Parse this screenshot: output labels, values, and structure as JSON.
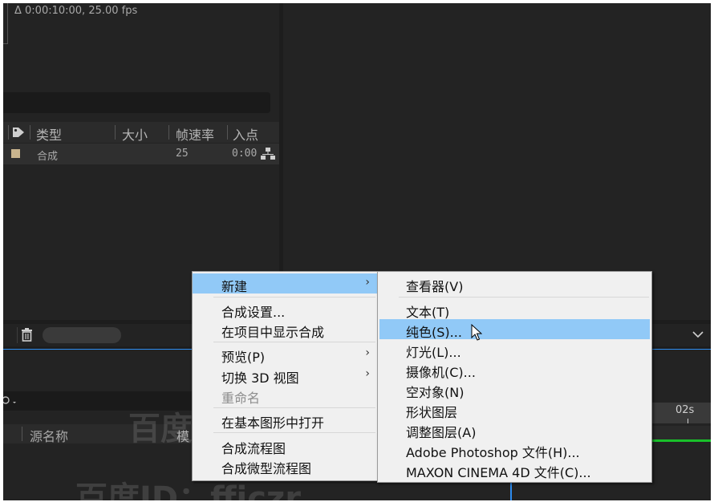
{
  "project_panel": {
    "comp_info": "Δ 0:00:10:00, 25.00 fps",
    "columns": {
      "type": "类型",
      "size": "大小",
      "framerate": "帧速率",
      "in_point": "入点"
    },
    "row": {
      "type": "合成",
      "framerate": "25",
      "in_point": "0:00"
    }
  },
  "timeline": {
    "source_name_col": "源名称",
    "mode_col_partial": "模",
    "time_marker": "02s"
  },
  "context_menu": {
    "items": [
      {
        "label": "新建",
        "submenu": "›"
      },
      {
        "label": "合成设置..."
      },
      {
        "label": "在项目中显示合成"
      },
      {
        "label": "预览(P)",
        "submenu": "›"
      },
      {
        "label": "切换 3D 视图",
        "submenu": "›"
      },
      {
        "label": "重命名",
        "disabled": true
      },
      {
        "label": "在基本图形中打开"
      },
      {
        "label": "合成流程图"
      },
      {
        "label": "合成微型流程图"
      }
    ]
  },
  "submenu": {
    "items": [
      {
        "label": "查看器(V)"
      },
      {
        "label": "文本(T)"
      },
      {
        "label": "纯色(S)..."
      },
      {
        "label": "灯光(L)..."
      },
      {
        "label": "摄像机(C)..."
      },
      {
        "label": "空对象(N)"
      },
      {
        "label": "形状图层"
      },
      {
        "label": "调整图层(A)"
      },
      {
        "label": "Adobe Photoshop 文件(H)..."
      },
      {
        "label": "MAXON CINEMA 4D 文件(C)..."
      }
    ]
  },
  "watermark": {
    "line1": "百度ID：ffjczr",
    "line2": "百度ID：ffjczr"
  },
  "colors": {
    "highlight": "#91c9f7",
    "timeline_green": "#19c02a",
    "accent_blue": "#2d8cf0"
  }
}
